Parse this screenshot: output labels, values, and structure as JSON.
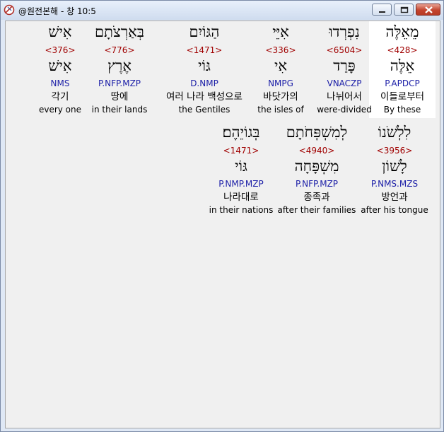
{
  "window": {
    "title": "@원전본해 - 창 10:5",
    "controls": [
      "minimize",
      "maximize",
      "close"
    ]
  },
  "rows": [
    {
      "words": [
        {
          "hebrew": "מֵאֵלֶּה",
          "strong": "<428>",
          "lemma": "אֵלֶּה",
          "morph": "P.APDCP",
          "korean": "이들로부터",
          "english": "By these",
          "selected": true
        },
        {
          "hebrew": "נִפְרְדוּ",
          "strong": "<6504>",
          "lemma": "פָּרַד",
          "morph": "VNACZP",
          "korean": "나뉘어서",
          "english": "were-divided",
          "selected": false
        },
        {
          "hebrew": "אִיֵּי",
          "strong": "<336>",
          "lemma": "אִי",
          "morph": "NMPG",
          "korean": "바닷가의",
          "english": "the isles of",
          "selected": false
        },
        {
          "hebrew": "הַגּוֹיִם",
          "strong": "<1471>",
          "lemma": "גּוֹי",
          "morph": "D.NMP",
          "korean": "여러 나라 백성으로",
          "english": "the Gentiles",
          "selected": false
        },
        {
          "hebrew": "בְּאַרְצֹתָם",
          "strong": "<776>",
          "lemma": "אֶרֶץ",
          "morph": "P.NFP.MZP",
          "korean": "땅에",
          "english": "in their lands",
          "selected": false
        },
        {
          "hebrew": "אִישׁ",
          "strong": "<376>",
          "lemma": "אִישׁ",
          "morph": "NMS",
          "korean": "각기",
          "english": "every one",
          "selected": false
        }
      ]
    },
    {
      "words": [
        {
          "hebrew": "לִלְשֹׁנוֹ",
          "strong": "<3956>",
          "lemma": "לָשׁוֹן",
          "morph": "P.NMS.MZS",
          "korean": "방언과",
          "english": "after his tongue",
          "selected": false
        },
        {
          "hebrew": "לְמִשְׁפְּחֹתָם",
          "strong": "<4940>",
          "lemma": "מִשְׁפָּחָה",
          "morph": "P.NFP.MZP",
          "korean": "종족과",
          "english": "after their families",
          "selected": false
        },
        {
          "hebrew": "בְּגוֹיֵהֶם׃",
          "strong": "<1471>",
          "lemma": "גּוֹי",
          "morph": "P.NMP.MZP",
          "korean": "나라대로",
          "english": "in their nations",
          "selected": false
        }
      ]
    }
  ]
}
